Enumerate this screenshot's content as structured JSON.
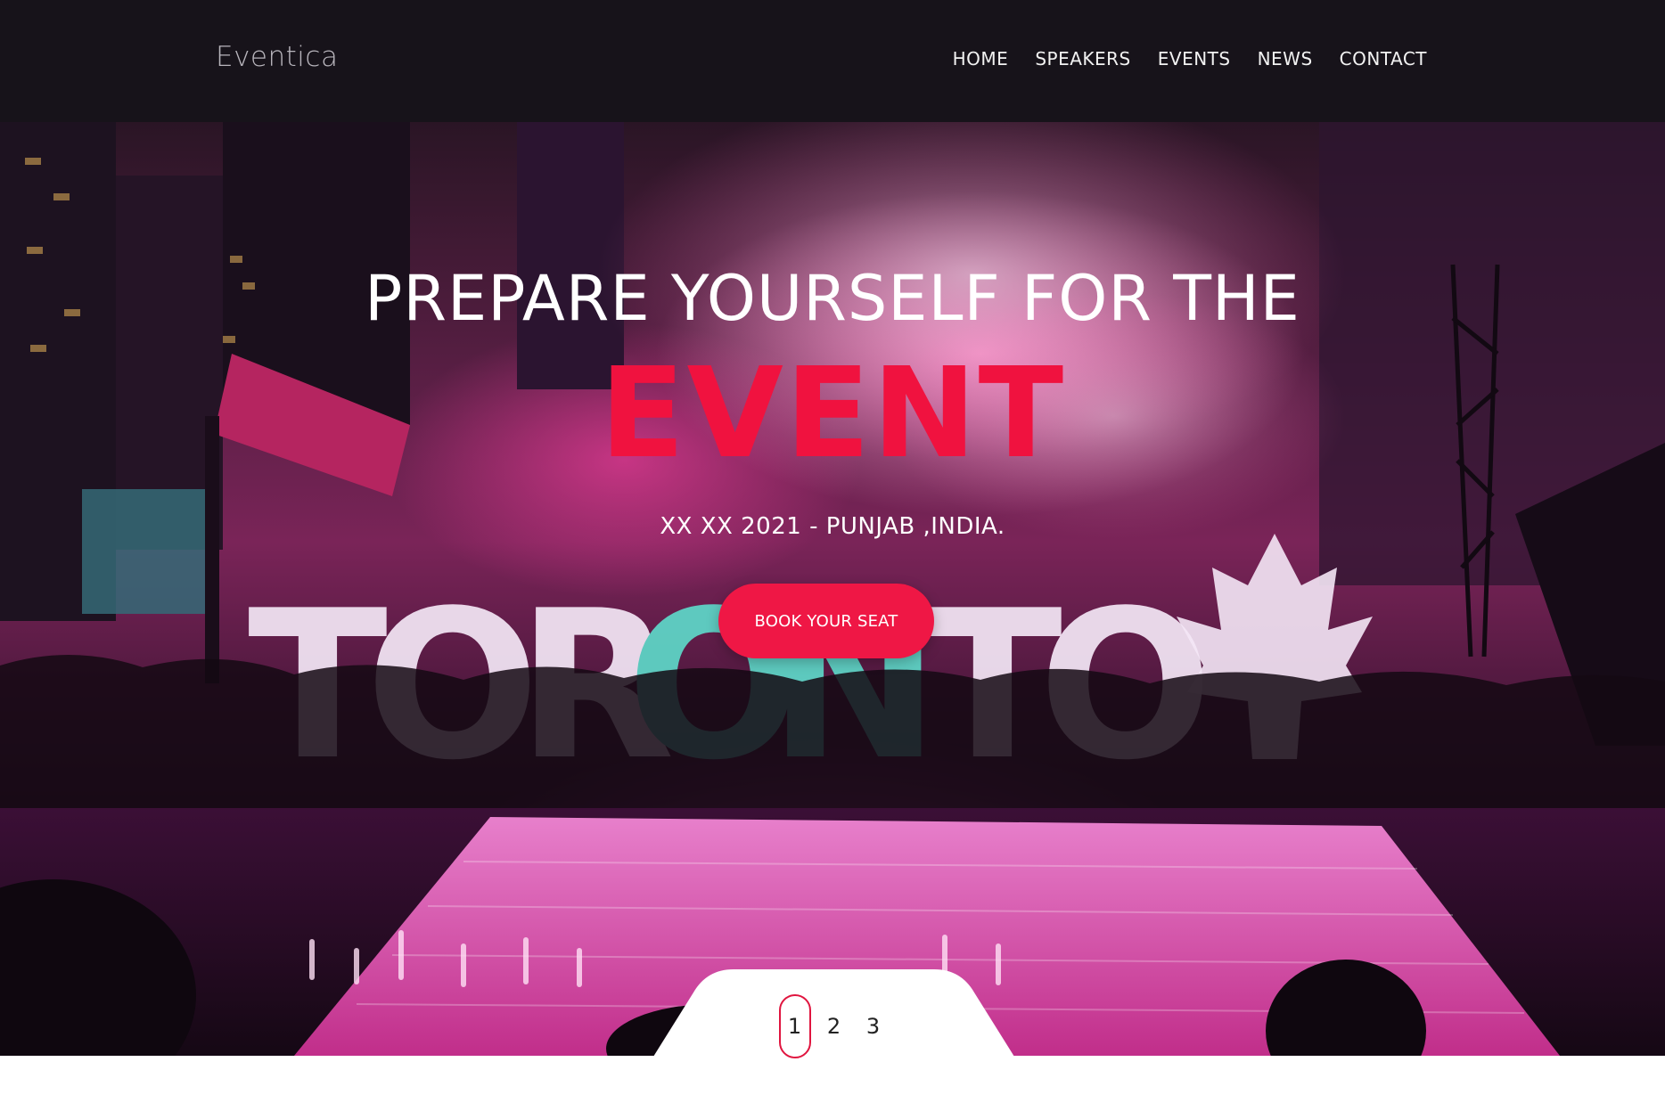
{
  "brand": "Eventica",
  "nav": {
    "items": [
      "HOME",
      "SPEAKERS",
      "EVENTS",
      "NEWS",
      "CONTACT"
    ]
  },
  "hero": {
    "title": "PREPARE YOURSELF FOR THE",
    "highlight": "EVENT",
    "subtitle": "XX XX 2021 - PUNJAB ,INDIA.",
    "cta": "BOOK YOUR SEAT",
    "background_sign": "TORONTO"
  },
  "pager": {
    "pages": [
      "1",
      "2",
      "3"
    ],
    "active": "1"
  },
  "colors": {
    "accent": "#ef1745",
    "nav_bg": "#17131a",
    "text_light": "#ffffff"
  }
}
